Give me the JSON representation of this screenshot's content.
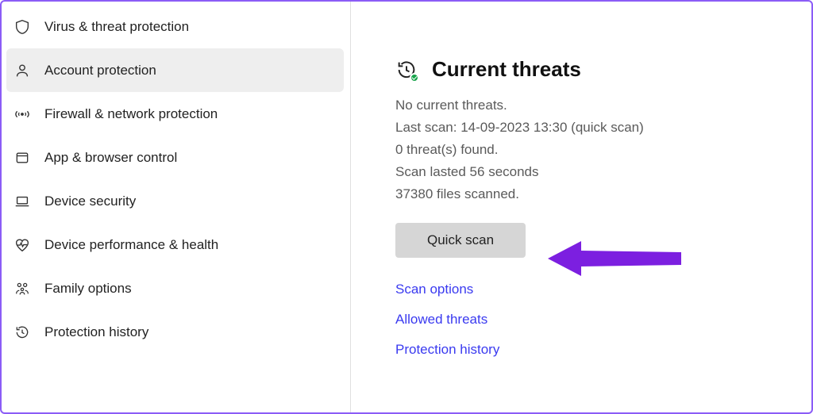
{
  "sidebar": {
    "items": [
      {
        "label": "Virus & threat protection"
      },
      {
        "label": "Account protection"
      },
      {
        "label": "Firewall & network protection"
      },
      {
        "label": "App & browser control"
      },
      {
        "label": "Device security"
      },
      {
        "label": "Device performance & health"
      },
      {
        "label": "Family options"
      },
      {
        "label": "Protection history"
      }
    ]
  },
  "main": {
    "heading": "Current threats",
    "status": {
      "line1": "No current threats.",
      "line2": "Last scan: 14-09-2023 13:30 (quick scan)",
      "line3": "0 threat(s) found.",
      "line4": "Scan lasted 56 seconds",
      "line5": "37380 files scanned."
    },
    "quick_scan_label": "Quick scan",
    "links": {
      "scan_options": "Scan options",
      "allowed_threats": "Allowed threats",
      "protection_history": "Protection history"
    }
  }
}
